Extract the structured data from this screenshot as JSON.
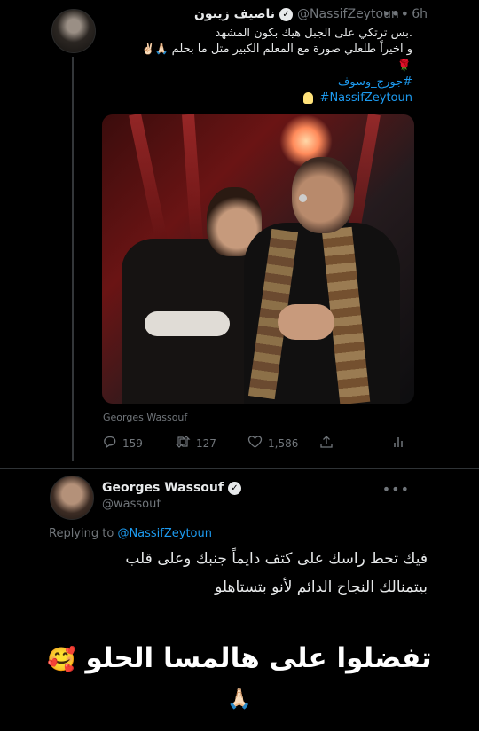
{
  "tweet1": {
    "display_name": "ناصيف زيتون",
    "handle": "@NassifZeytoun",
    "time": "6h",
    "text_line1": ".بس ترتكي على الجبل هيك بكون المشهد",
    "text_line2": "و اخيراً طلعلي صورة مع المعلم الكبير متل ما بحلم",
    "text_line2_emoji": "🙏🏻✌🏻",
    "rose": "🌹",
    "hashtag_arabic": "#جورج_وسوف",
    "bulb_icon": "light-bulb-icon",
    "hashtag_latin": "#NassifZeytoun",
    "media_source": "Georges Wassouf",
    "actions": {
      "replies": "159",
      "retweets": "127",
      "likes": "1,586"
    }
  },
  "tweet2": {
    "display_name": "Georges Wassouf",
    "handle": "@wassouf",
    "replying_prefix": "Replying to",
    "replying_to": "@NassifZeytoun",
    "text_line1": "فيك تحط راسك على كتف دايماً جنبك وعلى قلب",
    "text_line2": "بيتمنالك النجاح الدائم لأنو بتستاهلو"
  },
  "story_caption": {
    "text": "تفضلوا على هالمسا الحلو",
    "emoji": "🥰",
    "hands_emoji": "🙏🏻"
  },
  "colors": {
    "background": "#000000",
    "text": "#e7e9ea",
    "muted": "#71767b",
    "link": "#1d9bf0",
    "divider": "#2f3336"
  }
}
